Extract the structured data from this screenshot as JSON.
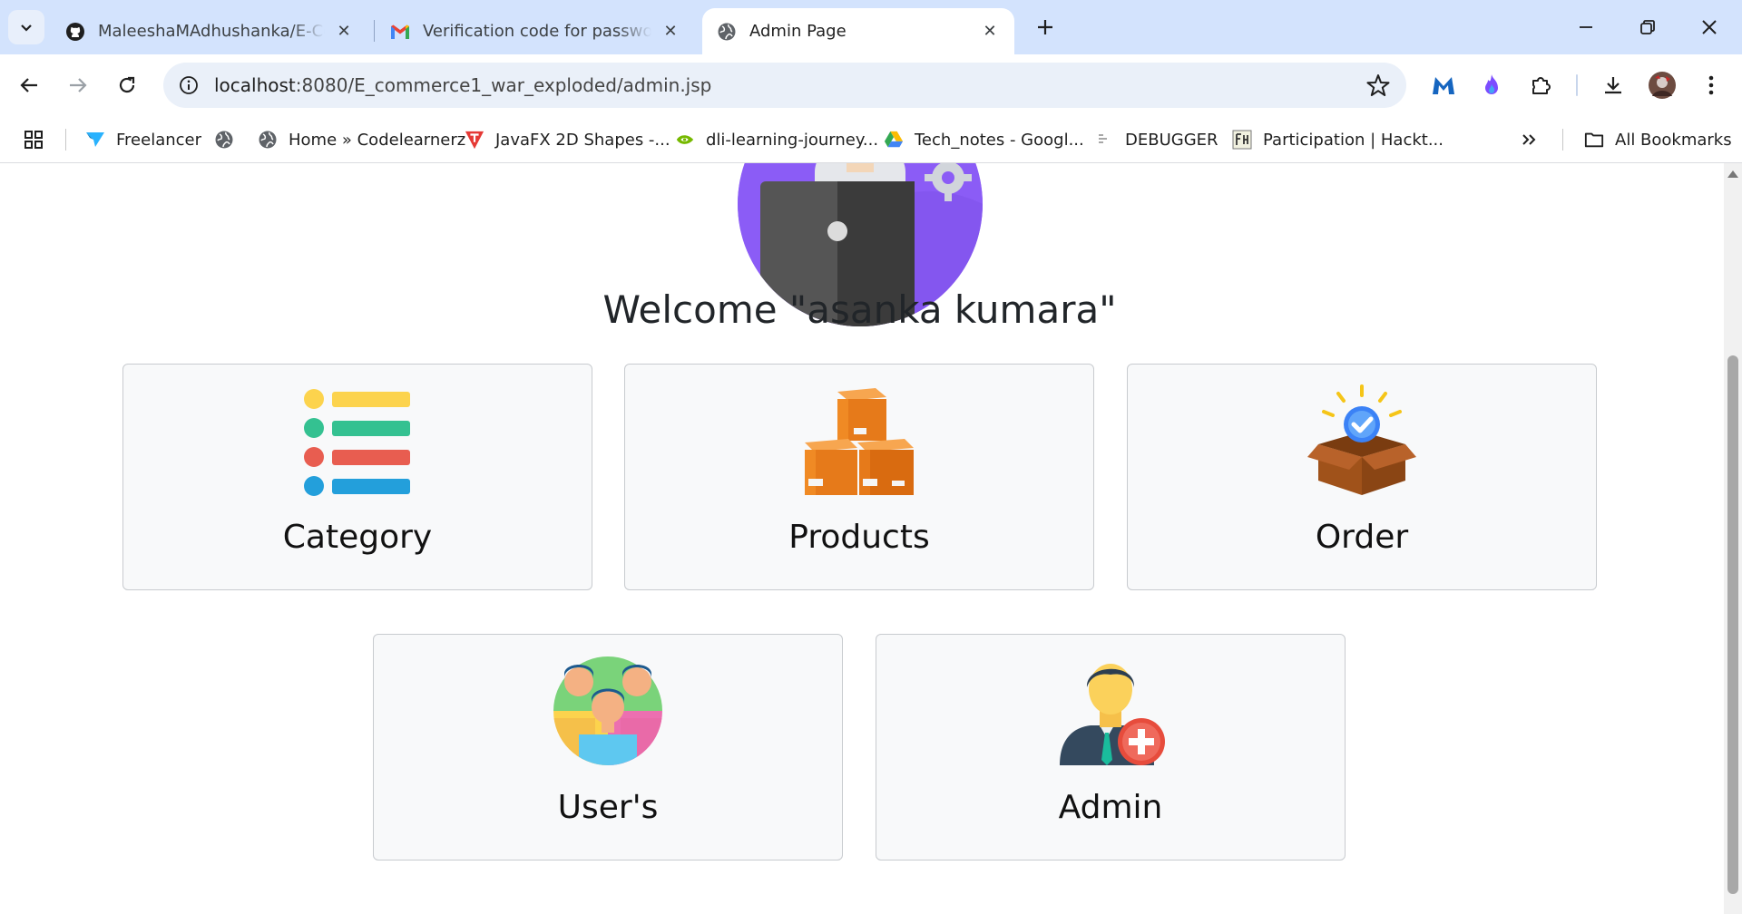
{
  "browser": {
    "tabs": [
      {
        "title": "MaleeshaMAdhushanka/E-Commerce",
        "favicon": "github-icon",
        "active": false
      },
      {
        "title": "Verification code for password change",
        "favicon": "gmail-icon",
        "active": false
      },
      {
        "title": "Admin Page",
        "favicon": "globe-icon",
        "active": true
      }
    ],
    "url_host": "localhost",
    "url_path": ":8080/E_commerce1_war_exploded/admin.jsp",
    "bookmarks": [
      {
        "label": "Freelancer",
        "icon": "freelancer-icon"
      },
      {
        "label": "",
        "icon": "globe-icon"
      },
      {
        "label": "Home » Codelearnerz",
        "icon": "globe-icon"
      },
      {
        "label": "JavaFX 2D Shapes -...",
        "icon": "tutorial-icon"
      },
      {
        "label": "dli-learning-journey...",
        "icon": "nvidia-icon"
      },
      {
        "label": "Tech_notes - Googl...",
        "icon": "drive-icon"
      },
      {
        "label": "DEBUGGER",
        "icon": "debugger-icon"
      },
      {
        "label": "Participation | Hackt...",
        "icon": "hackathon-icon"
      }
    ],
    "all_bookmarks_label": "All Bookmarks"
  },
  "page": {
    "welcome": "Welcome \"asanka kumara\"",
    "cards": [
      {
        "label": "Category",
        "icon": "category-list-icon"
      },
      {
        "label": "Products",
        "icon": "product-boxes-icon"
      },
      {
        "label": "Order",
        "icon": "order-box-icon"
      },
      {
        "label": "User's",
        "icon": "users-group-icon"
      },
      {
        "label": "Admin",
        "icon": "add-admin-icon"
      }
    ]
  },
  "colors": {
    "tabstrip": "#d3e3fd",
    "omnibox": "#eaf0f9",
    "card_bg": "#f8f9fa",
    "hero_purple": "#8b5cf6"
  }
}
